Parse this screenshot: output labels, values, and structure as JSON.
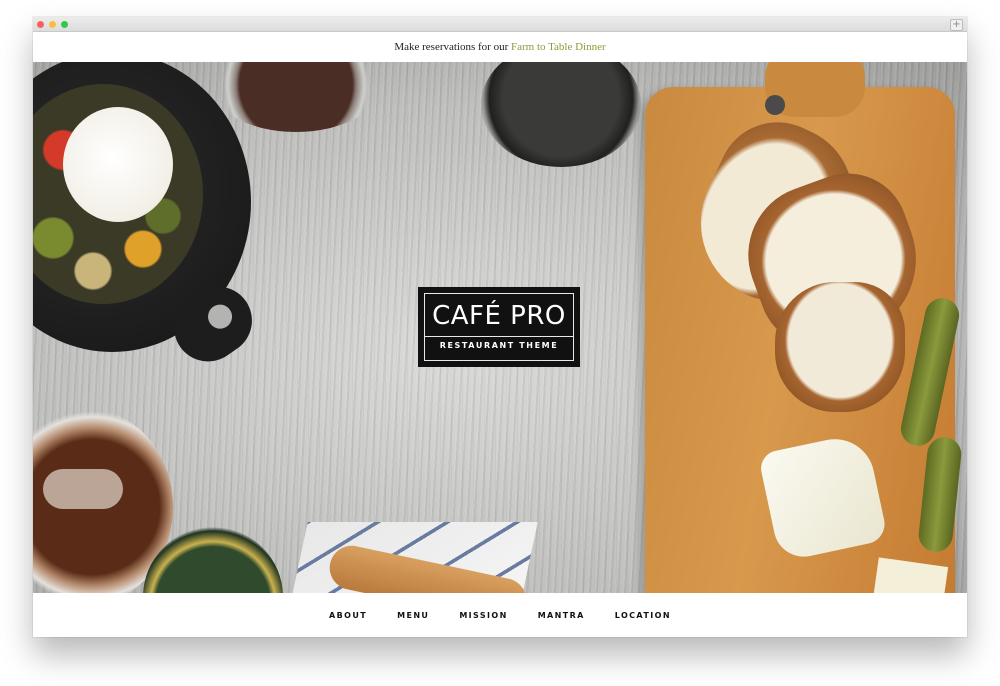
{
  "announcement": {
    "prefix": "Make reservations for our",
    "link_text": "Farm to Table Dinner"
  },
  "logo": {
    "title": "CAFÉ PRO",
    "subtitle": "RESTAURANT THEME"
  },
  "nav": {
    "items": [
      {
        "label": "ABOUT"
      },
      {
        "label": "MENU"
      },
      {
        "label": "MISSION"
      },
      {
        "label": "MANTRA"
      },
      {
        "label": "LOCATION"
      }
    ]
  },
  "colors": {
    "link_accent": "#8f9a3a",
    "logo_background": "#111111",
    "nav_text": "#111111"
  },
  "browser_chrome": {
    "icons": [
      "close-dot",
      "minimize-dot",
      "zoom-dot",
      "new-tab-plus-icon"
    ]
  }
}
